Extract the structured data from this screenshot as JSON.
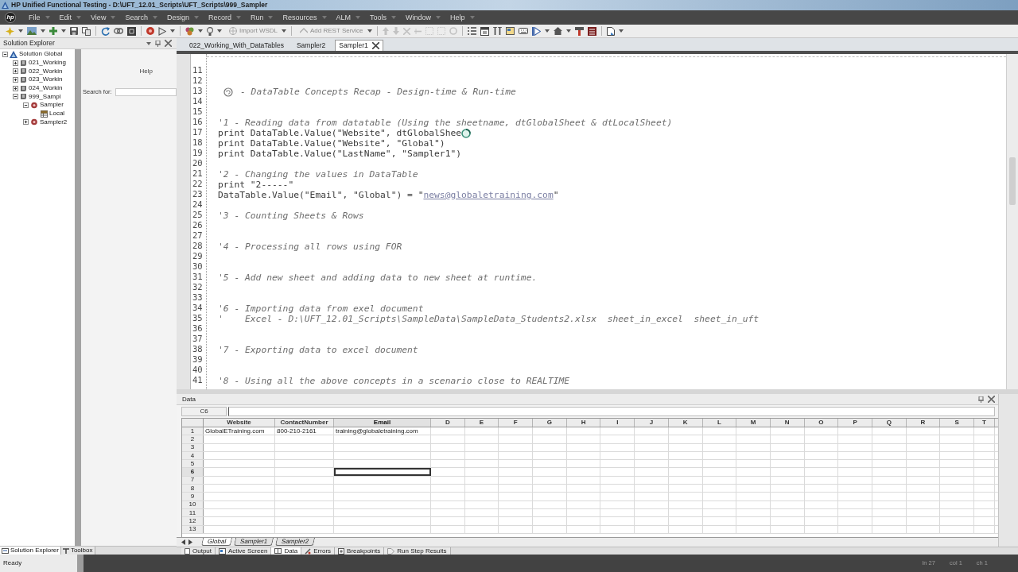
{
  "window": {
    "title": "HP Unified Functional Testing - D:\\UFT_12.01_Scripts\\UFT_Scripts\\999_Sampler"
  },
  "menu_bar": {
    "logo": "hp",
    "items": [
      "File",
      "Edit",
      "View",
      "Search",
      "Design",
      "Record",
      "Run",
      "Resources",
      "ALM",
      "Tools",
      "Window",
      "Help"
    ]
  },
  "toolbar": {
    "buttons": [
      {
        "label": "Import WSDL",
        "disabled": true
      },
      {
        "label": "Add REST Service",
        "disabled": true
      }
    ]
  },
  "solution_explorer": {
    "title": "Solution Explorer",
    "tree": [
      {
        "label": "Solution Global",
        "kind": "solution",
        "expanded": true,
        "children": [
          {
            "label": "021_Working",
            "kind": "test",
            "expanded": false
          },
          {
            "label": "022_Workin",
            "kind": "test",
            "expanded": false
          },
          {
            "label": "023_Workin",
            "kind": "test",
            "expanded": false
          },
          {
            "label": "024_Workin",
            "kind": "test",
            "expanded": false
          },
          {
            "label": "999_Sampl",
            "kind": "test",
            "expanded": true,
            "children": [
              {
                "label": "Sampler",
                "kind": "action",
                "expanded": true,
                "children": [
                  {
                    "label": "Local",
                    "kind": "datasheet"
                  }
                ]
              },
              {
                "label": "Sampler2",
                "kind": "action",
                "expanded": false
              }
            ]
          }
        ]
      }
    ]
  },
  "overlay_window": {
    "menu": [
      "Help"
    ],
    "search_label": "Search for:"
  },
  "document_tabs": [
    {
      "label": "022_Working_With_DataTables",
      "selected": false
    },
    {
      "label": "Sampler2",
      "selected": false
    },
    {
      "label": "Sampler1",
      "selected": true
    }
  ],
  "editor": {
    "lines": [
      {
        "number": "11"
      },
      {
        "number": "12"
      },
      {
        "number": "13",
        "kind": "marked",
        "text": "- DataTable Concepts Recap - Design-time & Run-time"
      },
      {
        "number": "14"
      },
      {
        "number": "15"
      },
      {
        "number": "16",
        "kind": "comment",
        "text": "'1 - Reading data from datatable (Using the sheetname, dtGlobalSheet & dtLocalSheet)"
      },
      {
        "number": "17",
        "kind": "code",
        "text": "print DataTable.Value(\"Website\", dtGlobalShee",
        "pointer": {
          "kind": "busy"
        }
      },
      {
        "number": "18",
        "kind": "code",
        "text": "print DataTable.Value(\"Website\", \"Global\")"
      },
      {
        "number": "19",
        "kind": "code",
        "text": "print DataTable.Value(\"LastName\", \"Sampler1\")"
      },
      {
        "number": "20"
      },
      {
        "number": "21",
        "kind": "comment",
        "text": "'2 - Changing the values in DataTable"
      },
      {
        "number": "22",
        "kind": "code",
        "text": "print \"2-----\""
      },
      {
        "number": "23",
        "kind": "code",
        "text": "DataTable.Value(\"Email\", \"Global\") = \"",
        "link": "news@globaletraining.com",
        "text_after": "\""
      },
      {
        "number": "24"
      },
      {
        "number": "25",
        "kind": "comment",
        "text": "'3 - Counting Sheets & Rows"
      },
      {
        "number": "26"
      },
      {
        "number": "27"
      },
      {
        "number": "28",
        "kind": "comment",
        "text": "'4 - Processing all rows using FOR"
      },
      {
        "number": "29"
      },
      {
        "number": "30"
      },
      {
        "number": "31",
        "kind": "comment",
        "text": "'5 - Add new sheet and adding data to new sheet at runtime."
      },
      {
        "number": "32"
      },
      {
        "number": "33"
      },
      {
        "number": "34",
        "kind": "comment",
        "text": "'6 - Importing data from exel document"
      },
      {
        "number": "35",
        "kind": "comment",
        "text": "'    Excel - D:\\UFT_12.01_Scripts\\SampleData\\SampleData_Students2.xlsx  sheet_in_excel  sheet_in_uft"
      },
      {
        "number": "36"
      },
      {
        "number": "37"
      },
      {
        "number": "38",
        "kind": "comment",
        "text": "'7 - Exporting data to excel document"
      },
      {
        "number": "39"
      },
      {
        "number": "40"
      },
      {
        "number": "41",
        "kind": "comment",
        "text": "'8 - Using all the above concepts in a scenario close to REALTIME"
      }
    ]
  },
  "data_panel": {
    "title": "Data",
    "name_box": "C6",
    "columns": [
      {
        "label": "Website",
        "selected": false
      },
      {
        "label": "ContactNumber",
        "selected": false
      },
      {
        "label": "Email",
        "selected": true
      },
      {
        "label": "D",
        "selected": false
      },
      {
        "label": "E",
        "selected": false
      },
      {
        "label": "F",
        "selected": false
      },
      {
        "label": "G",
        "selected": false
      },
      {
        "label": "H",
        "selected": false
      },
      {
        "label": "I",
        "selected": false
      },
      {
        "label": "J",
        "selected": false
      },
      {
        "label": "K",
        "selected": false
      },
      {
        "label": "L",
        "selected": false
      },
      {
        "label": "M",
        "selected": false
      },
      {
        "label": "N",
        "selected": false
      },
      {
        "label": "O",
        "selected": false
      },
      {
        "label": "P",
        "selected": false
      },
      {
        "label": "Q",
        "selected": false
      },
      {
        "label": "R",
        "selected": false
      },
      {
        "label": "S",
        "selected": false
      },
      {
        "label": "T",
        "selected": false
      }
    ],
    "rows": [
      {
        "number": "1",
        "selected": false,
        "cells": [
          "GlobalETraining.com",
          "800-210-2161",
          "training@globaletraining.com"
        ]
      },
      {
        "number": "2",
        "selected": false
      },
      {
        "number": "3",
        "selected": false
      },
      {
        "number": "4",
        "selected": false
      },
      {
        "number": "5",
        "selected": false
      },
      {
        "number": "6",
        "selected": true
      },
      {
        "number": "7",
        "selected": false
      },
      {
        "number": "8",
        "selected": false
      },
      {
        "number": "9",
        "selected": false
      },
      {
        "number": "10",
        "selected": false
      },
      {
        "number": "11",
        "selected": false
      },
      {
        "number": "12",
        "selected": false
      },
      {
        "number": "13",
        "selected": false
      }
    ],
    "sheet_tabs": [
      {
        "label": "Global",
        "selected": true
      },
      {
        "label": "Sampler1",
        "selected": false
      },
      {
        "label": "Sampler2",
        "selected": false
      }
    ]
  },
  "left_bottom_tabs": [
    {
      "label": "Solution Explorer",
      "selected": true
    },
    {
      "label": "Toolbox",
      "selected": false
    }
  ],
  "bottom_tabs": [
    {
      "label": "Output",
      "selected": false
    },
    {
      "label": "Active Screen",
      "selected": false
    },
    {
      "label": "Data",
      "selected": true
    },
    {
      "label": "Errors",
      "selected": false
    },
    {
      "label": "Breakpoints",
      "selected": false
    },
    {
      "label": "Run Step Results",
      "selected": false
    }
  ],
  "status_bar": {
    "text": "Ready",
    "position": [
      "ln 27",
      "col 1",
      "ch 1"
    ]
  }
}
